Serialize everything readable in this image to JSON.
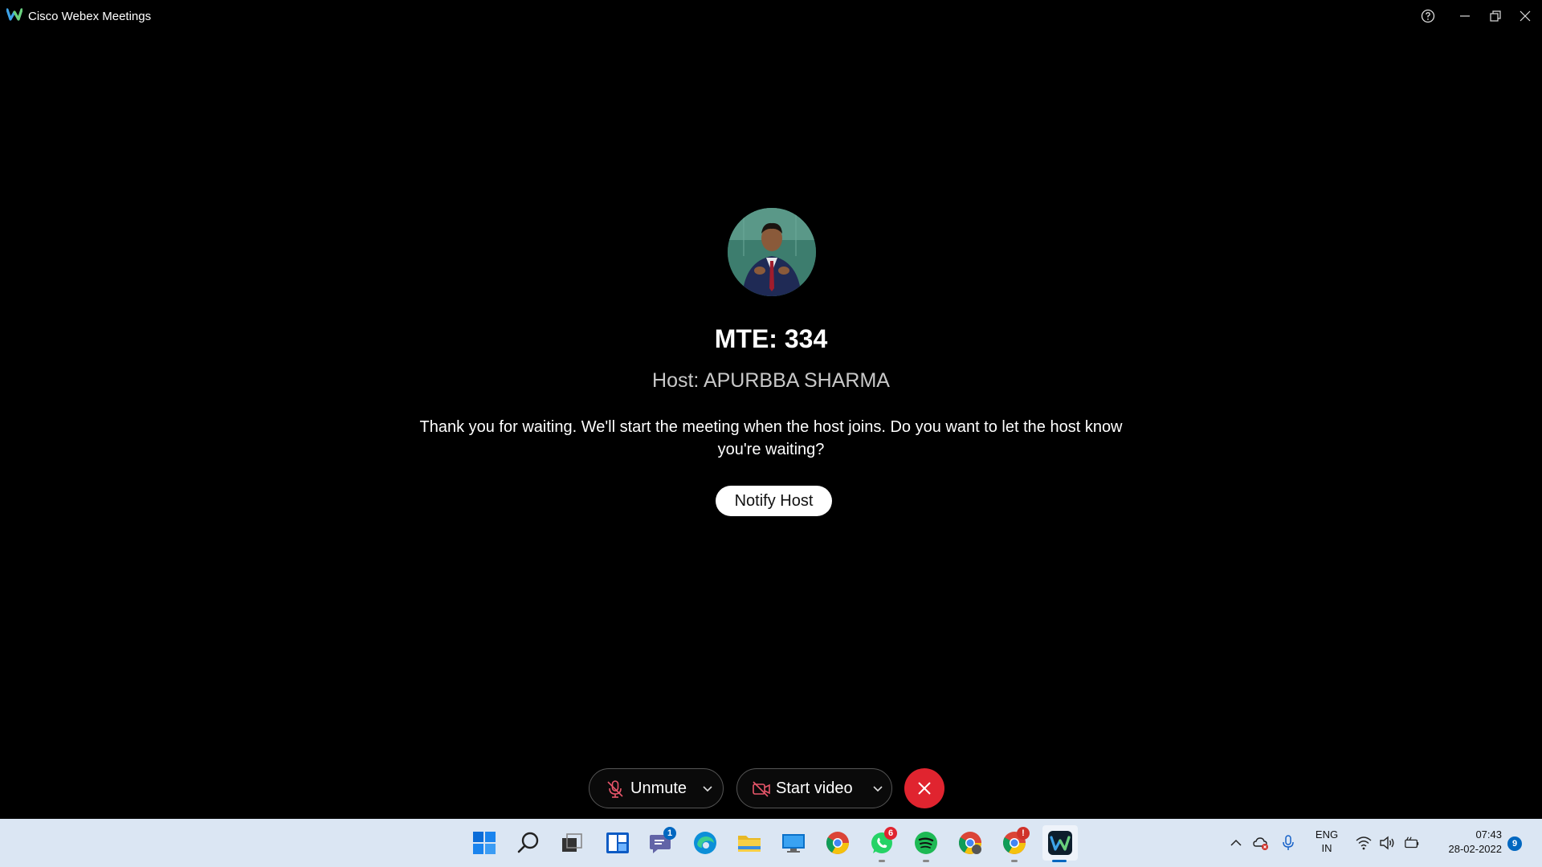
{
  "window": {
    "title": "Cisco Webex Meetings"
  },
  "meeting": {
    "title": "MTE: 334",
    "host_line": "Host: APURBBA SHARMA",
    "message": "Thank you for waiting. We'll start the meeting when the host joins. Do you want to let the host know you're waiting?",
    "notify_label": "Notify Host"
  },
  "controls": {
    "unmute_label": "Unmute",
    "video_label": "Start video"
  },
  "taskbar": {
    "badges": {
      "teams": "1",
      "whatsapp": "6",
      "chrome_profile": "!"
    },
    "lang_primary": "ENG",
    "lang_secondary": "IN",
    "time": "07:43",
    "date": "28-02-2022",
    "notifications": "9"
  },
  "colors": {
    "leave": "#e0242f",
    "taskbar": "#dbe6f3",
    "accent": "#0067c0"
  }
}
